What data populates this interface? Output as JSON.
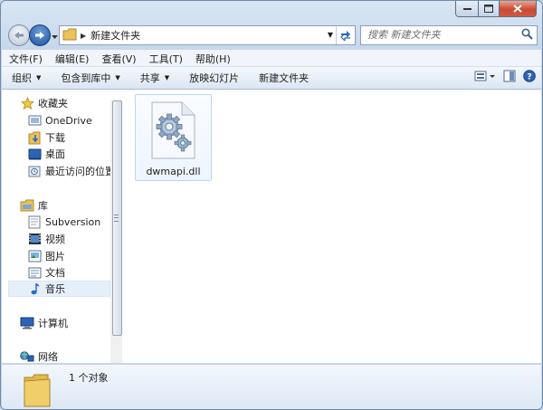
{
  "window": {
    "title_path": "新建文件夹",
    "caption_buttons": [
      "minimize-icon",
      "maximize-icon",
      "close-icon"
    ]
  },
  "search": {
    "placeholder": "搜索 新建文件夹"
  },
  "menu": {
    "items": [
      "文件(F)",
      "编辑(E)",
      "查看(V)",
      "工具(T)",
      "帮助(H)"
    ]
  },
  "toolbar": {
    "organize": "组织",
    "include_in_library": "包含到库中",
    "share": "共享",
    "slideshow": "放映幻灯片",
    "new_folder": "新建文件夹"
  },
  "sidebar": {
    "groups": [
      {
        "label": "收藏夹",
        "icon": "star-icon",
        "items": [
          {
            "label": "OneDrive",
            "icon": "onedrive-icon"
          },
          {
            "label": "下载",
            "icon": "downloads-icon"
          },
          {
            "label": "桌面",
            "icon": "desktop-icon"
          },
          {
            "label": "最近访问的位置",
            "icon": "recent-places-icon"
          }
        ]
      },
      {
        "label": "库",
        "icon": "libraries-icon",
        "items": [
          {
            "label": "Subversion",
            "icon": "subversion-icon"
          },
          {
            "label": "视频",
            "icon": "video-icon"
          },
          {
            "label": "图片",
            "icon": "pictures-icon"
          },
          {
            "label": "文档",
            "icon": "documents-icon"
          },
          {
            "label": "音乐",
            "icon": "music-icon"
          }
        ]
      },
      {
        "label": "计算机",
        "icon": "computer-icon",
        "items": []
      },
      {
        "label": "网络",
        "icon": "network-icon",
        "items": []
      }
    ],
    "selected": "音乐"
  },
  "files": [
    {
      "name": "dwmapi.dll",
      "icon": "dll-gear-icon"
    }
  ],
  "status": {
    "text": "1 个对象"
  },
  "colors": {
    "accent": "#1a4f9e",
    "selection": "#e6eff9",
    "close": "#c94b34"
  }
}
